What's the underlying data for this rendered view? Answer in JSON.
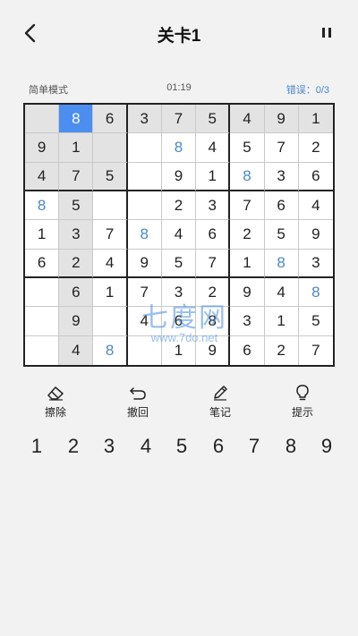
{
  "header": {
    "title": "关卡1"
  },
  "status": {
    "mode": "简单模式",
    "timer": "01:19",
    "errors": "错误：0/3"
  },
  "board": {
    "rows": [
      [
        "",
        "8",
        "6",
        "3",
        "7",
        "5",
        "4",
        "9",
        "1"
      ],
      [
        "9",
        "1",
        "",
        "",
        "8",
        "4",
        "5",
        "7",
        "2"
      ],
      [
        "4",
        "7",
        "5",
        "",
        "9",
        "1",
        "8",
        "3",
        "6"
      ],
      [
        "8",
        "5",
        "",
        "",
        "2",
        "3",
        "7",
        "6",
        "4"
      ],
      [
        "1",
        "3",
        "7",
        "8",
        "4",
        "6",
        "2",
        "5",
        "9"
      ],
      [
        "6",
        "2",
        "4",
        "9",
        "5",
        "7",
        "1",
        "8",
        "3"
      ],
      [
        "",
        "6",
        "1",
        "7",
        "3",
        "2",
        "9",
        "4",
        "8"
      ],
      [
        "",
        "9",
        "",
        "4",
        "6",
        "8",
        "3",
        "1",
        "5"
      ],
      [
        "",
        "4",
        "8",
        "",
        "1",
        "9",
        "6",
        "2",
        "7"
      ]
    ],
    "user_filled": [
      [
        1,
        4
      ],
      [
        2,
        6
      ],
      [
        3,
        0
      ],
      [
        4,
        3
      ],
      [
        5,
        7
      ],
      [
        6,
        8
      ],
      [
        8,
        2
      ]
    ],
    "selected": [
      0,
      1
    ],
    "highlight_color": "#e3e3e3",
    "selected_color": "#4c8ef0",
    "user_color": "#4a88c8"
  },
  "watermark": {
    "big": "七度网",
    "small": "www.7do.net"
  },
  "tools": [
    {
      "label": "擦除",
      "icon": "eraser-icon"
    },
    {
      "label": "撤回",
      "icon": "undo-icon"
    },
    {
      "label": "笔记",
      "icon": "pencil-icon"
    },
    {
      "label": "提示",
      "icon": "lightbulb-icon"
    }
  ],
  "numpad": [
    "1",
    "2",
    "3",
    "4",
    "5",
    "6",
    "7",
    "8",
    "9"
  ]
}
